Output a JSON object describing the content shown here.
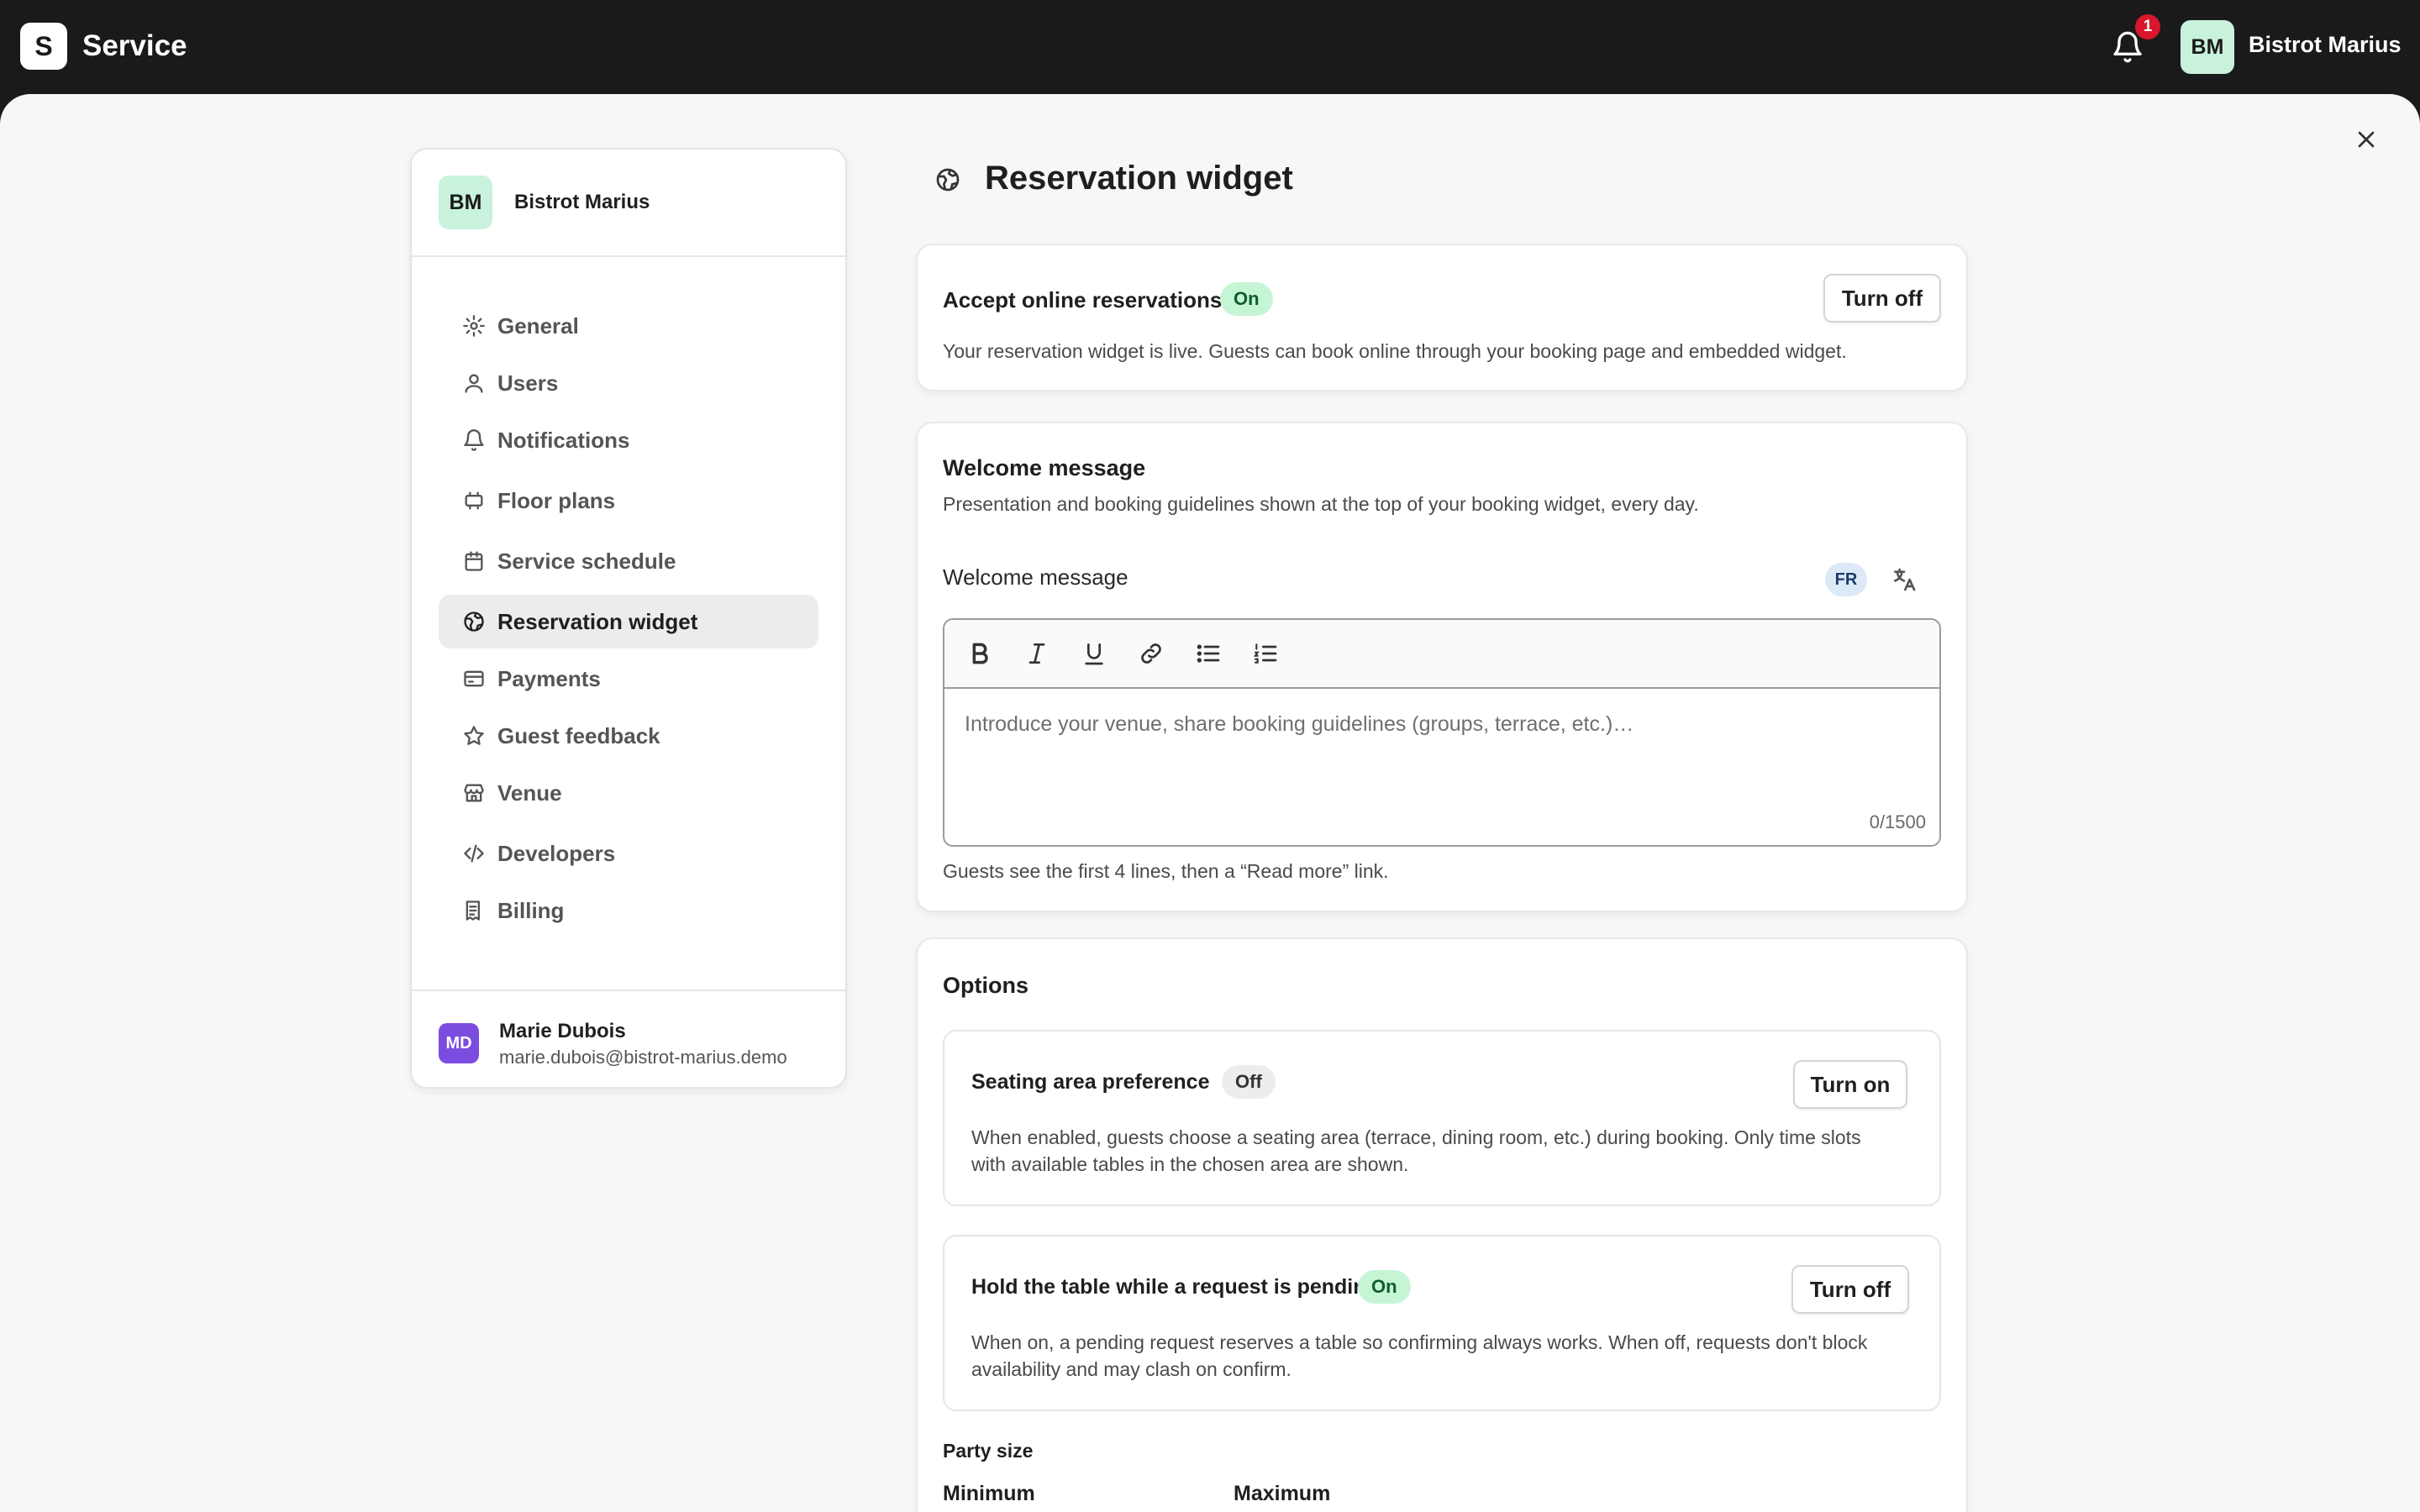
{
  "app": {
    "logo_letter": "S",
    "name": "Service"
  },
  "topbar": {
    "notification_count": "1",
    "user_initials": "BM",
    "user_name": "Bistrot Marius"
  },
  "sidebar": {
    "header": {
      "initials": "BM",
      "name": "Bistrot Marius"
    },
    "items": [
      {
        "label": "General",
        "icon": "gear-icon"
      },
      {
        "label": "Users",
        "icon": "user-icon"
      },
      {
        "label": "Notifications",
        "icon": "bell-icon"
      },
      {
        "label": "Floor plans",
        "icon": "floor-plan-icon"
      },
      {
        "label": "Service schedule",
        "icon": "calendar-icon"
      },
      {
        "label": "Reservation widget",
        "icon": "globe-icon",
        "active": true
      },
      {
        "label": "Payments",
        "icon": "credit-card-icon"
      },
      {
        "label": "Guest feedback",
        "icon": "star-icon"
      },
      {
        "label": "Venue",
        "icon": "store-icon"
      },
      {
        "label": "Developers",
        "icon": "code-icon"
      },
      {
        "label": "Billing",
        "icon": "receipt-icon"
      }
    ],
    "footer": {
      "initials": "MD",
      "name": "Marie Dubois",
      "email": "marie.dubois@bistrot-marius.demo"
    }
  },
  "page": {
    "title": "Reservation widget"
  },
  "online": {
    "title": "Accept online reservations",
    "status": "On",
    "button": "Turn off",
    "description": "Your reservation widget is live. Guests can book online through your booking page and embedded widget."
  },
  "welcome": {
    "title": "Welcome message",
    "description": "Presentation and booking guidelines shown at the top of your booking widget, every day.",
    "field_label": "Welcome message",
    "language": "FR",
    "placeholder": "Introduce your venue, share booking guidelines (groups, terrace, etc.)…",
    "char_count": "0/1500",
    "helper": "Guests see the first 4 lines, then a “Read more” link."
  },
  "options": {
    "title": "Options",
    "seating": {
      "title": "Seating area preference",
      "status": "Off",
      "button": "Turn on",
      "description_line1": "When enabled, guests choose a seating area (terrace, dining room, etc.) during booking. Only time slots",
      "description_line2": "with available tables in the chosen area are shown."
    },
    "hold": {
      "title": "Hold the table while a request is pending",
      "status": "On",
      "button": "Turn off",
      "description_line1": "When on, a pending request reserves a table so confirming always works. When off, requests don't block",
      "description_line2": "availability and may clash on confirm."
    },
    "party_size": {
      "title": "Party size",
      "minimum": "Minimum",
      "maximum": "Maximum"
    }
  }
}
